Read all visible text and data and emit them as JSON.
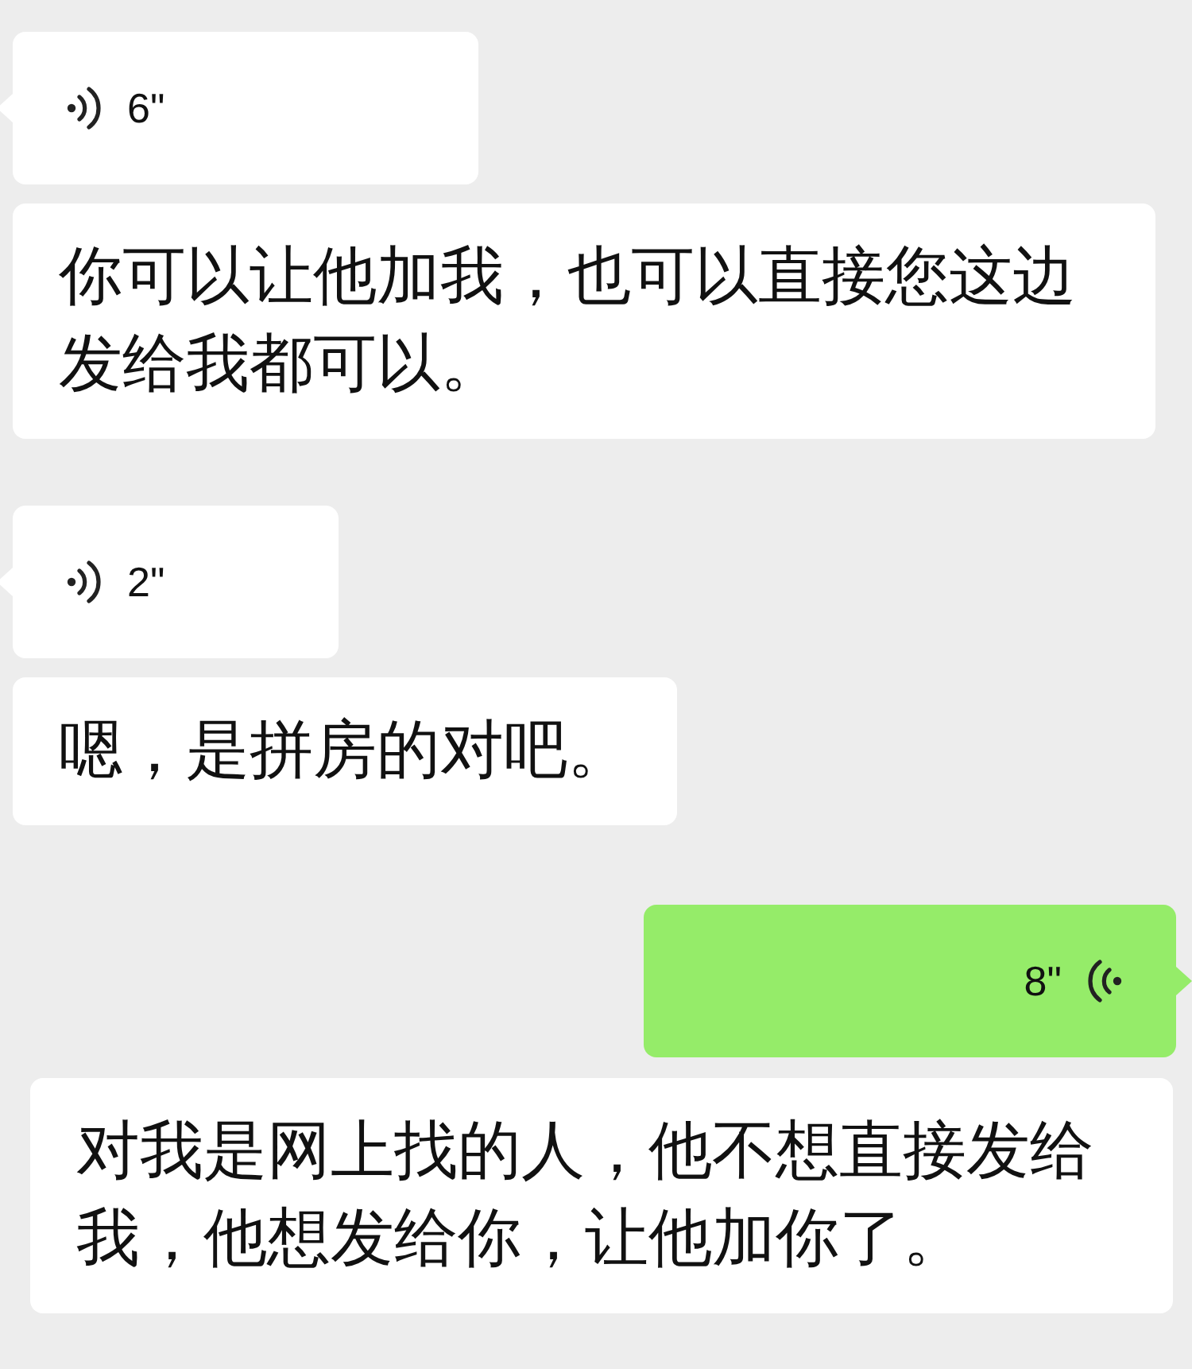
{
  "messages": [
    {
      "outgoing": false,
      "duration": "6\"",
      "transcript": "你可以让他加我，也可以直接您这边发给我都可以。"
    },
    {
      "outgoing": false,
      "duration": "2\"",
      "transcript": "嗯，是拼房的对吧。"
    },
    {
      "outgoing": true,
      "duration": "8\"",
      "transcript": "对我是网上找的人，他不想直接发给我，他想发给你，让他加你了。"
    }
  ]
}
